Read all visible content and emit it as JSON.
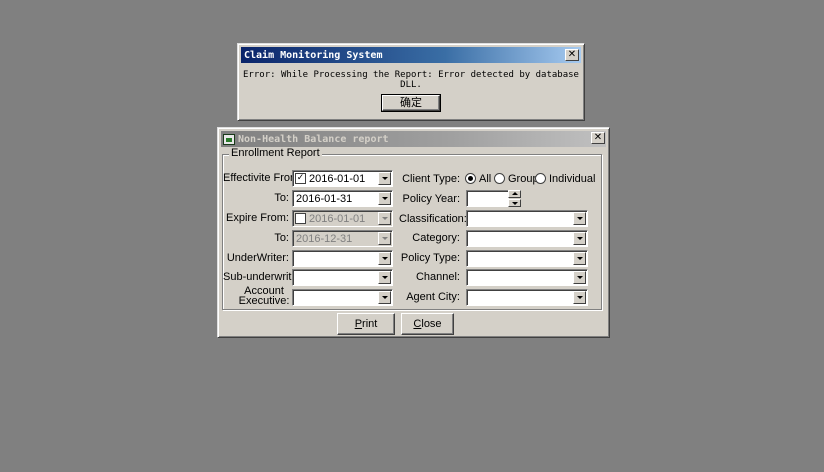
{
  "error_dialog": {
    "title": "Claim Monitoring System",
    "message": "Error: While Processing the Report: Error detected by database DLL.",
    "ok_label": "确定"
  },
  "report_window": {
    "title": "Non-Health Balance report",
    "group_title": "Enrollment Report",
    "left": {
      "effective_from_label": "Effectivite From:",
      "effective_from_value": "2016-01-01",
      "effective_from_checked": true,
      "effective_to_label": "To:",
      "effective_to_value": "2016-01-31",
      "expire_from_label": "Expire From:",
      "expire_from_value": "2016-01-01",
      "expire_from_checked": false,
      "expire_to_label": "To:",
      "expire_to_value": "2016-12-31",
      "underwriter_label": "UnderWriter:",
      "underwriter_value": "",
      "sub_underwriter_label": "Sub-underwriter:",
      "sub_underwriter_value": "",
      "account_exec_label_line1": "Account",
      "account_exec_label_line2": "Executive:",
      "account_exec_value": ""
    },
    "right": {
      "client_type_label": "Client Type:",
      "client_type_options": [
        "All",
        "Group",
        "Individual"
      ],
      "client_type_selected": "All",
      "policy_year_label": "Policy Year:",
      "policy_year_value": "",
      "classification_label": "Classification:",
      "category_label": "Category:",
      "policy_type_label": "Policy Type:",
      "channel_label": "Channel:",
      "agent_city_label": "Agent City:"
    },
    "buttons": {
      "print_prefix": "",
      "print_underline": "P",
      "print_rest": "rint",
      "close_underline": "C",
      "close_rest": "lose"
    }
  },
  "icons": {
    "close": "close-icon",
    "app": "app-window-icon",
    "check": "✓"
  },
  "colors": {
    "desktop": "#808080",
    "face": "#d4d0c8",
    "active_title_start": "#0a246a",
    "active_title_end": "#a6caf0"
  }
}
